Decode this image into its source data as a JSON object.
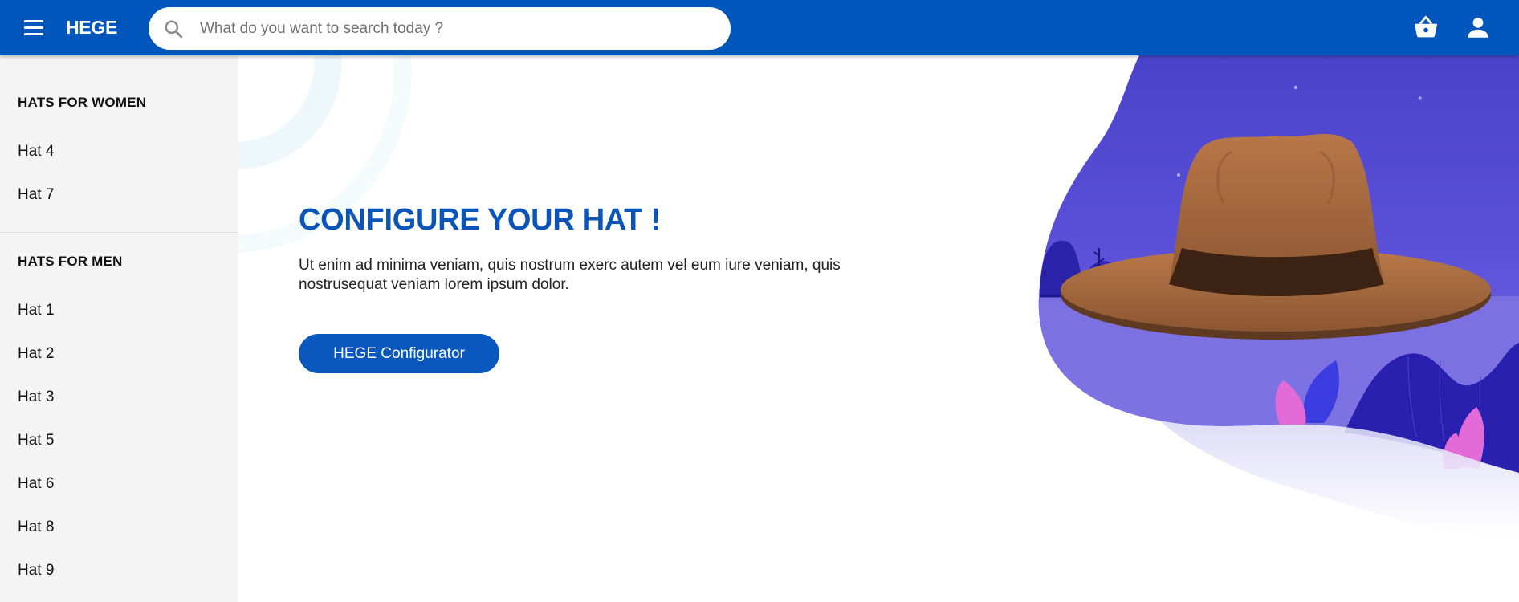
{
  "header": {
    "brand": "HEGE",
    "search": {
      "placeholder": "What do you want to search today ?",
      "value": ""
    },
    "icons": [
      "menu-icon",
      "search-icon",
      "basket-icon",
      "account-icon"
    ]
  },
  "sidebar": {
    "sections": [
      {
        "title": "HATS FOR WOMEN",
        "items": [
          "Hat 4",
          "Hat 7"
        ]
      },
      {
        "title": "HATS FOR MEN",
        "items": [
          "Hat 1",
          "Hat 2",
          "Hat 3",
          "Hat 5",
          "Hat 6",
          "Hat 8",
          "Hat 9"
        ]
      }
    ]
  },
  "hero": {
    "title": "CONFIGURE YOUR HAT !",
    "text": "Ut enim ad minima veniam, quis nostrum exerc autem vel eum iure veniam, quis nostrusequat veniam lorem ipsum dolor.",
    "button_label": "HEGE Configurator"
  },
  "colors": {
    "primary": "#0056bb",
    "title_blue": "#0b55b8",
    "sidebar_bg": "#f4f4f4",
    "illustration_purple": "#5b4fd6"
  }
}
